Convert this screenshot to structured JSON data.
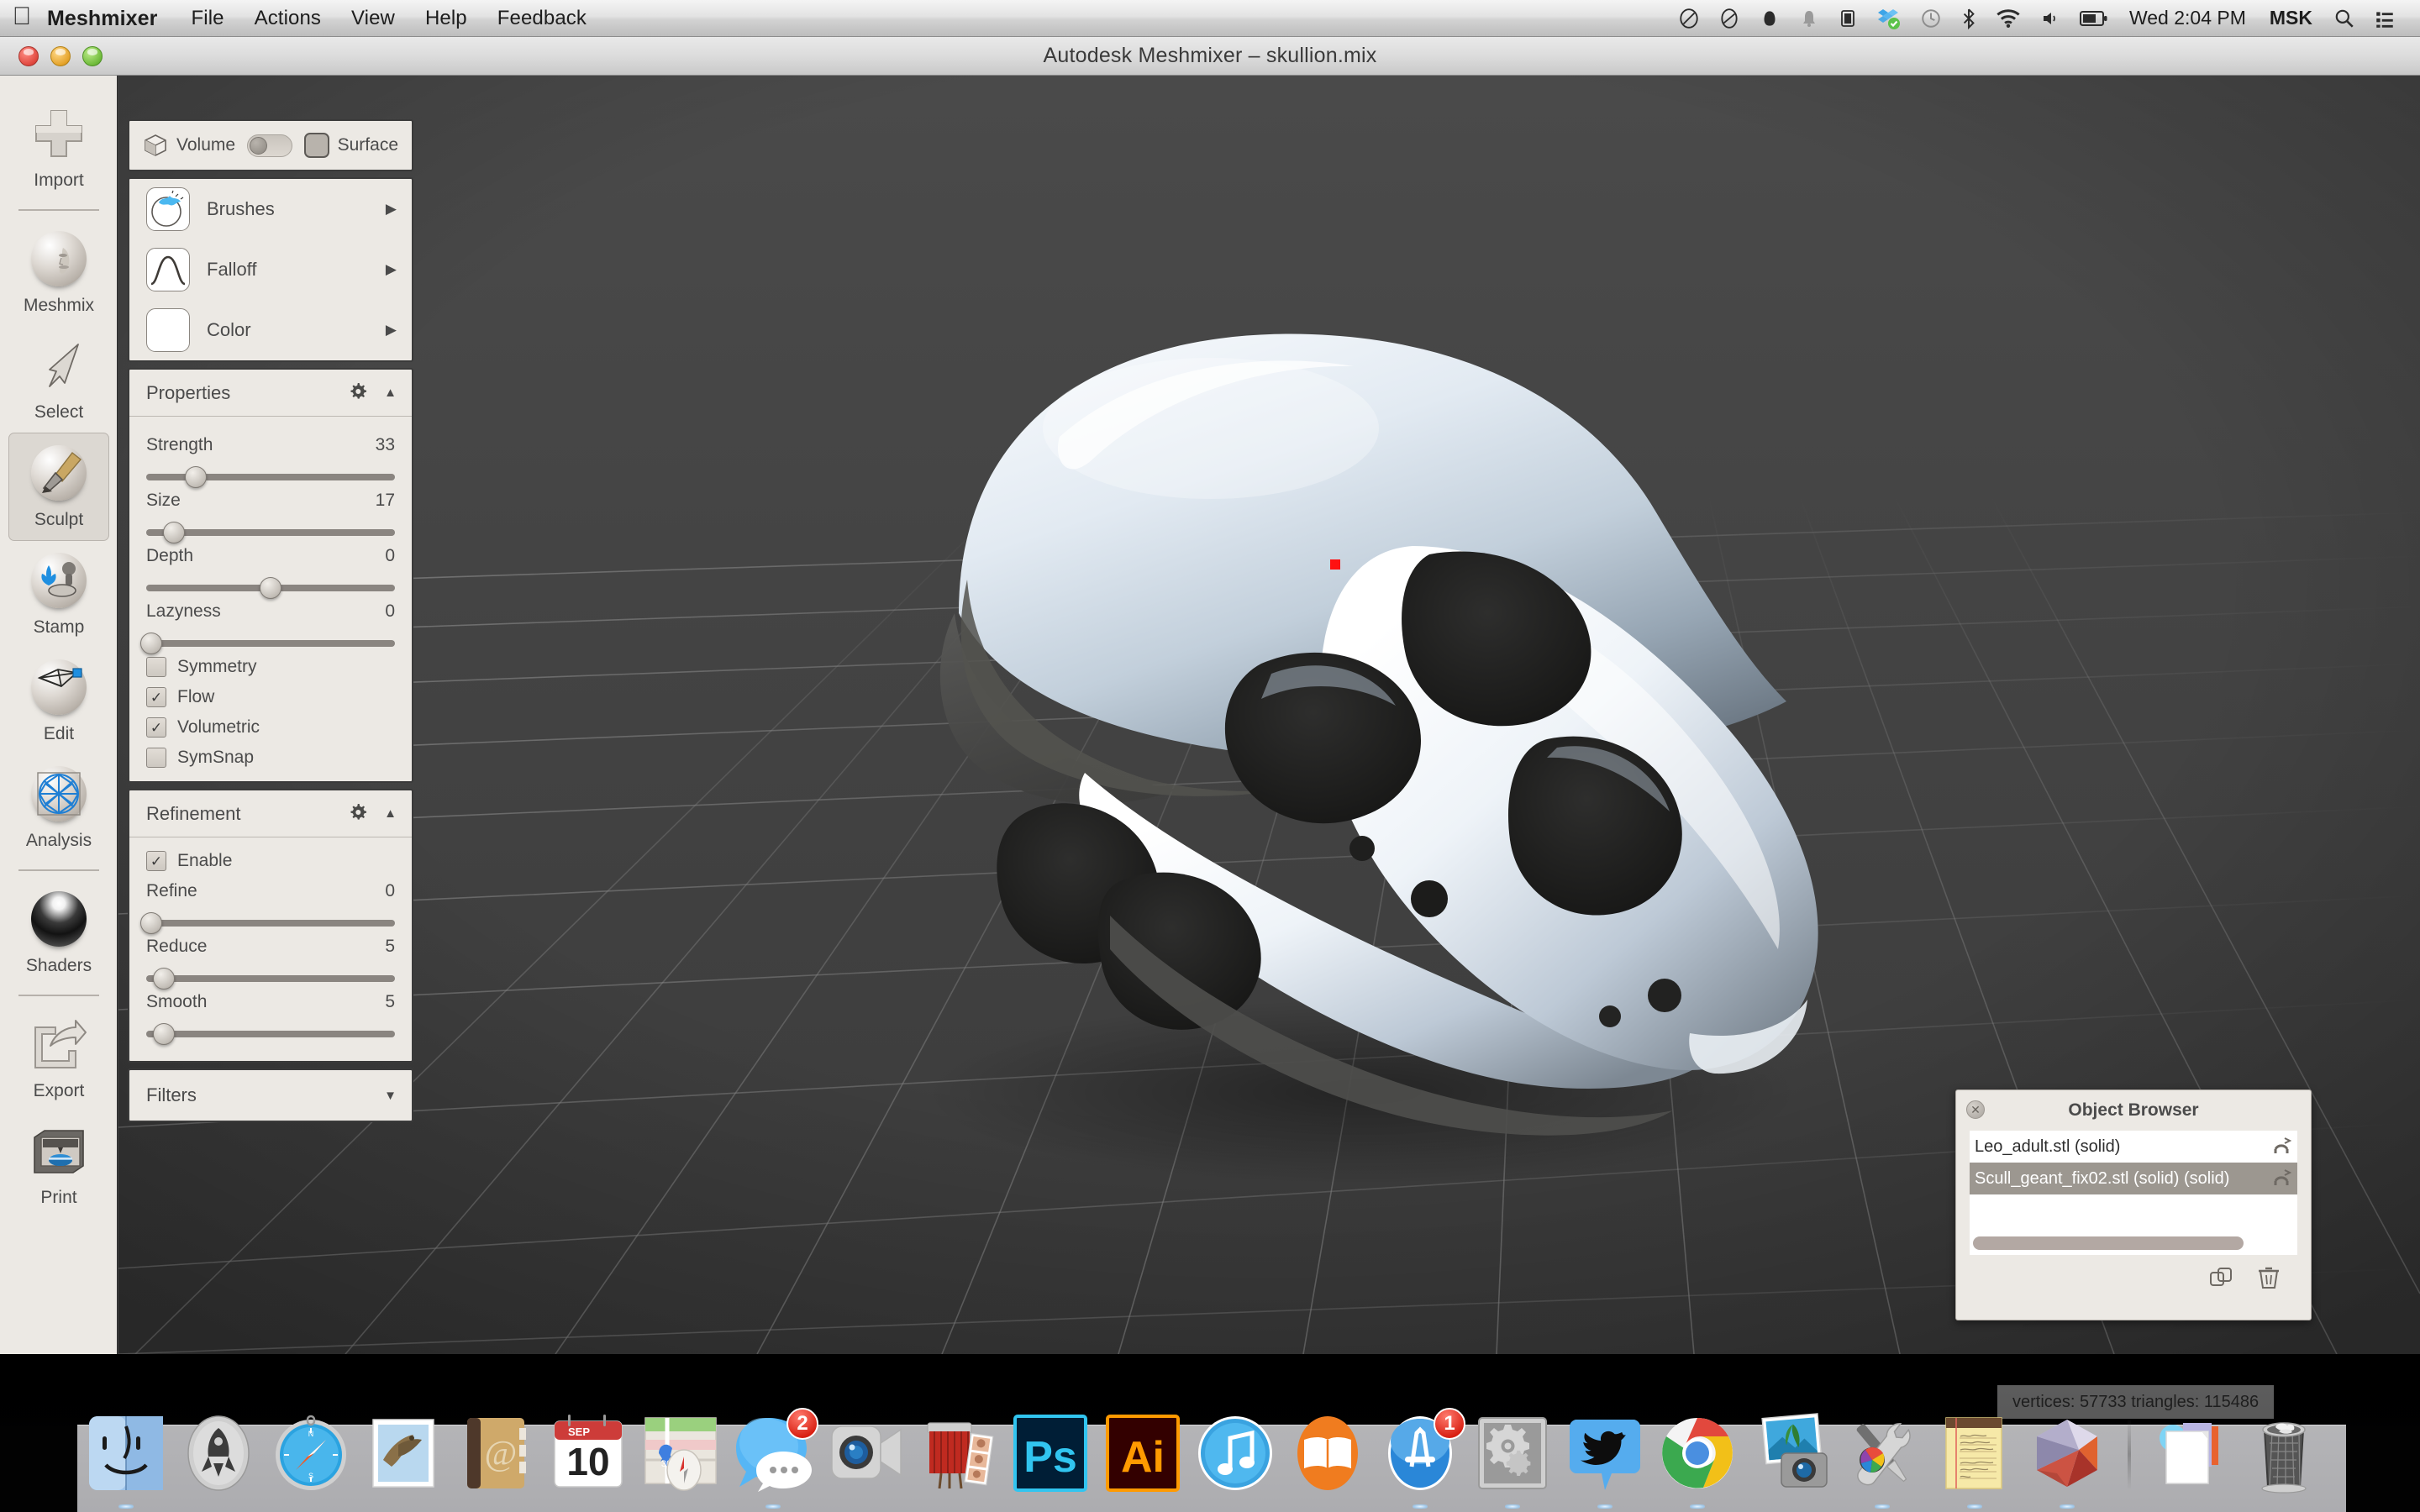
{
  "menubar": {
    "apple_icon": "apple-logo-icon",
    "app_name": "Meshmixer",
    "menus": [
      "File",
      "Actions",
      "View",
      "Help",
      "Feedback"
    ],
    "status_icons": [
      "do-not-disturb-icon",
      "cloud-slash-icon",
      "dropbox-dark-icon",
      "bell-icon",
      "display-mirror-icon",
      "dropbox-sync-icon",
      "time-machine-icon",
      "bluetooth-icon",
      "wifi-icon",
      "volume-icon",
      "battery-icon"
    ],
    "clock": "Wed 2:04 PM",
    "input_source": "MSK",
    "search_icon": "search-icon",
    "notification_center_icon": "list-icon"
  },
  "window": {
    "title": "Autodesk Meshmixer – skullion.mix",
    "traffic_lights": [
      "close-button",
      "minimize-button",
      "zoom-button"
    ]
  },
  "toolbar": {
    "items": [
      {
        "label": "Import",
        "icon": "plus-icon",
        "active": false,
        "divider_after": true
      },
      {
        "label": "Meshmix",
        "icon": "face-sphere-icon",
        "active": false,
        "divider_after": false
      },
      {
        "label": "Select",
        "icon": "cursor-arrow-icon",
        "active": false,
        "divider_after": false
      },
      {
        "label": "Sculpt",
        "icon": "brush-sphere-icon",
        "active": true,
        "divider_after": false
      },
      {
        "label": "Stamp",
        "icon": "stamp-sphere-icon",
        "active": false,
        "divider_after": false
      },
      {
        "label": "Edit",
        "icon": "mesh-sphere-icon",
        "active": false,
        "divider_after": false
      },
      {
        "label": "Analysis",
        "icon": "wireframe-sphere-icon",
        "active": false,
        "divider_after": true
      },
      {
        "label": "Shaders",
        "icon": "shaded-sphere-icon",
        "active": false,
        "divider_after": true
      },
      {
        "label": "Export",
        "icon": "export-arrow-icon",
        "active": false,
        "divider_after": false
      },
      {
        "label": "Print",
        "icon": "3d-printer-icon",
        "active": false,
        "divider_after": false
      }
    ]
  },
  "panel": {
    "mode_bar": {
      "cube_icon": "cube-icon",
      "volume_label": "Volume",
      "toggle_state": "off",
      "surface_swatch_icon": "rounded-square-icon",
      "surface_label": "Surface"
    },
    "brush_rows": [
      {
        "label": "Brushes",
        "icon": "brush-preview-icon",
        "arrow": "▶"
      },
      {
        "label": "Falloff",
        "icon": "falloff-curve-icon",
        "arrow": "▶"
      },
      {
        "label": "Color",
        "icon": "color-swatch-icon",
        "arrow": "▶"
      }
    ],
    "properties": {
      "title": "Properties",
      "gear_icon": "gear-icon",
      "collapse_icon": "triangle-up-icon",
      "sliders": [
        {
          "label": "Strength",
          "value": "33",
          "pct": 33
        },
        {
          "label": "Size",
          "value": "17",
          "pct": 17
        },
        {
          "label": "Depth",
          "value": "0",
          "pct": 50
        },
        {
          "label": "Lazyness",
          "value": "0",
          "pct": 2
        }
      ],
      "checkboxes": [
        {
          "label": "Symmetry",
          "checked": false
        },
        {
          "label": "Flow",
          "checked": true
        },
        {
          "label": "Volumetric",
          "checked": true
        },
        {
          "label": "SymSnap",
          "checked": false
        }
      ]
    },
    "refinement": {
      "title": "Refinement",
      "gear_icon": "gear-icon",
      "collapse_icon": "triangle-up-icon",
      "enable": {
        "label": "Enable",
        "checked": true
      },
      "sliders": [
        {
          "label": "Refine",
          "value": "0",
          "pct": 2
        },
        {
          "label": "Reduce",
          "value": "5",
          "pct": 7
        },
        {
          "label": "Smooth",
          "value": "5",
          "pct": 7
        }
      ]
    },
    "filters": {
      "title": "Filters",
      "expand_icon": "triangle-down-icon"
    }
  },
  "viewport": {
    "cursor_color": "#ff1111",
    "background_color": "#434343",
    "grid_color": "#6d6d6d"
  },
  "object_browser": {
    "title": "Object Browser",
    "close_icon": "close-icon",
    "rows": [
      {
        "name": "Leo_adult.stl (solid)",
        "selected": false,
        "action_icon": "magnet-icon"
      },
      {
        "name": "Scull_geant_fix02.stl (solid) (solid)",
        "selected": true,
        "action_icon": "magnet-icon"
      }
    ],
    "footer_icons": [
      "duplicate-icon",
      "trash-icon"
    ]
  },
  "status": {
    "text": "vertices: 57733 triangles: 115486"
  },
  "dock": {
    "items": [
      {
        "name": "finder",
        "badge": null,
        "running": true
      },
      {
        "name": "launchpad",
        "badge": null,
        "running": false
      },
      {
        "name": "safari",
        "badge": null,
        "running": true
      },
      {
        "name": "mail",
        "badge": null,
        "running": false
      },
      {
        "name": "contacts",
        "badge": null,
        "running": false
      },
      {
        "name": "calendar",
        "badge": null,
        "running": false
      },
      {
        "name": "maps",
        "badge": null,
        "running": false
      },
      {
        "name": "messages",
        "badge": "2",
        "running": true
      },
      {
        "name": "facetime",
        "badge": null,
        "running": false
      },
      {
        "name": "photo-booth",
        "badge": null,
        "running": false
      },
      {
        "name": "photoshop",
        "badge": null,
        "running": false
      },
      {
        "name": "illustrator",
        "badge": null,
        "running": false
      },
      {
        "name": "itunes",
        "badge": null,
        "running": false
      },
      {
        "name": "ibooks",
        "badge": null,
        "running": false
      },
      {
        "name": "app-store",
        "badge": "1",
        "running": true
      },
      {
        "name": "system-preferences",
        "badge": null,
        "running": true
      },
      {
        "name": "twitter",
        "badge": null,
        "running": true
      },
      {
        "name": "chrome",
        "badge": null,
        "running": true
      },
      {
        "name": "iphoto",
        "badge": null,
        "running": false
      },
      {
        "name": "utilities",
        "badge": null,
        "running": true
      },
      {
        "name": "notes",
        "badge": null,
        "running": true
      },
      {
        "name": "meshmixer",
        "badge": null,
        "running": true
      },
      {
        "name": "separator",
        "badge": null,
        "running": false
      },
      {
        "name": "documents-stack",
        "badge": null,
        "running": false
      },
      {
        "name": "trash",
        "badge": null,
        "running": false
      }
    ]
  }
}
